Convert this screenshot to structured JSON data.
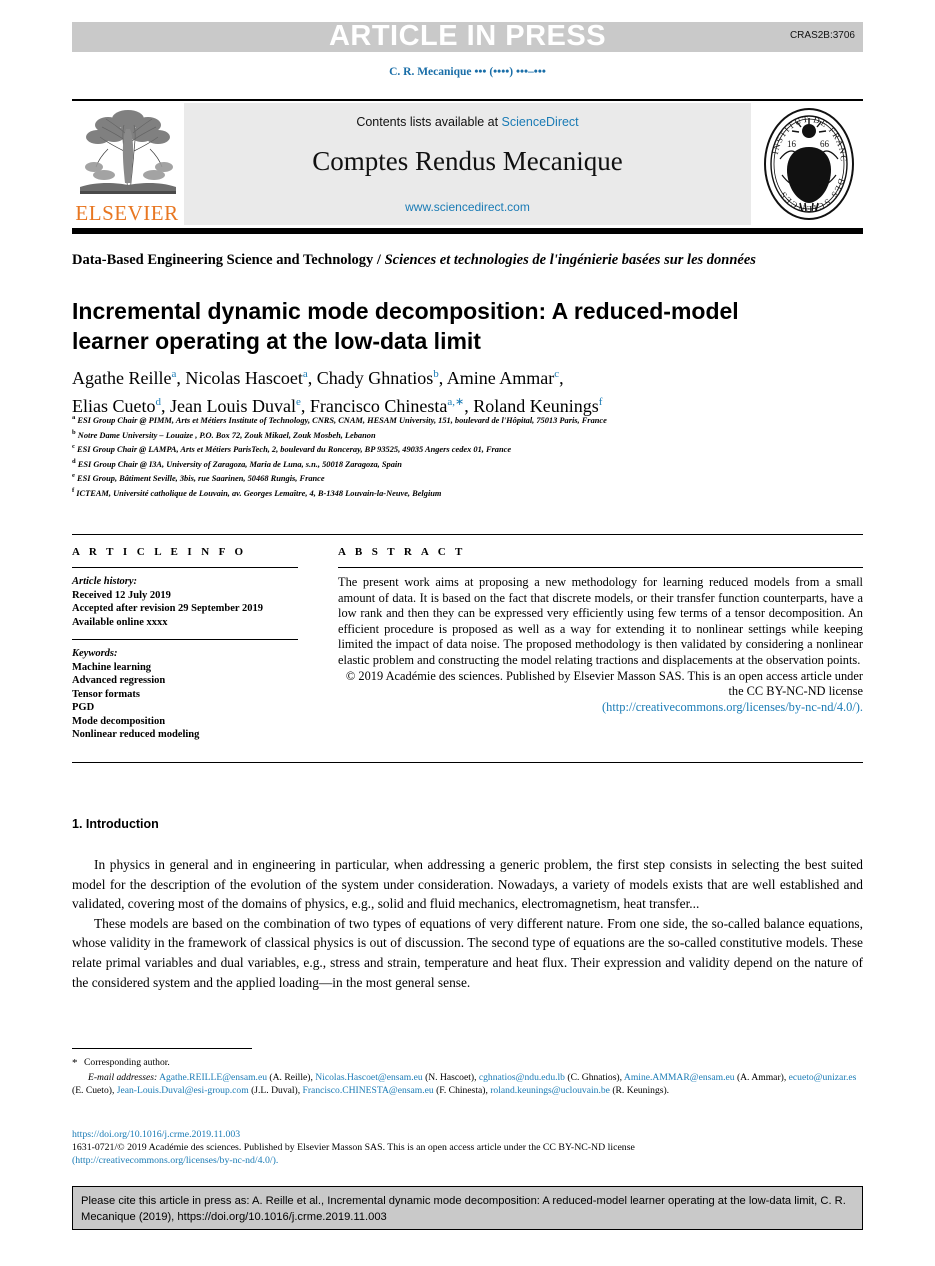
{
  "banner": {
    "label": "ARTICLE IN PRESS",
    "code": "CRAS2B:3706"
  },
  "running_head": "C. R. Mecanique ••• (••••) •••–•••",
  "masthead": {
    "contents_prefix": "Contents lists available at ",
    "sciencedirect": "ScienceDirect",
    "journal_title": "Comptes Rendus Mecanique",
    "url": "www.sciencedirect.com",
    "publisher_logo_text": "ELSEVIER",
    "seal_name": "academie-des-sciences-seal"
  },
  "series_line_en": "Data-Based Engineering Science and Technology / ",
  "series_line_fr": "Sciences et technologies de l'ingénierie basées sur les données",
  "title": "Incremental dynamic mode decomposition: A reduced-model learner operating at the low-data limit",
  "authors": [
    {
      "name": "Agathe Reille",
      "marks": "a",
      "sep": ", "
    },
    {
      "name": "Nicolas Hascoet",
      "marks": "a",
      "sep": ", "
    },
    {
      "name": "Chady Ghnatios",
      "marks": "b",
      "sep": ", "
    },
    {
      "name": "Amine Ammar",
      "marks": "c",
      "sep": ","
    },
    {
      "name": "Elias Cueto",
      "marks": "d",
      "sep": ", "
    },
    {
      "name": "Jean Louis Duval",
      "marks": "e",
      "sep": ", "
    },
    {
      "name": "Francisco Chinesta",
      "marks": "a,∗",
      "sep": ", "
    },
    {
      "name": "Roland Keunings",
      "marks": "f",
      "sep": ""
    }
  ],
  "affiliations": [
    {
      "mark": "a",
      "text": "ESI Group Chair @ PIMM, Arts et Métiers Institute of Technology, CNRS, CNAM, HESAM University, 151, boulevard de l'Hôpital, 75013 Paris, France"
    },
    {
      "mark": "b",
      "text": "Notre Dame University – Louaize , P.O. Box 72, Zouk Mikael, Zouk Mosbeh, Lebanon"
    },
    {
      "mark": "c",
      "text": "ESI Group Chair @ LAMPA, Arts et Métiers ParisTech, 2, boulevard du Ronceray, BP 93525, 49035 Angers cedex 01, France"
    },
    {
      "mark": "d",
      "text": "ESI Group Chair @ I3A, University of Zaragoza, Maria de Luna, s.n., 50018 Zaragoza, Spain"
    },
    {
      "mark": "e",
      "text": "ESI Group, Bâtiment Seville, 3bis, rue Saarinen, 50468 Rungis, France"
    },
    {
      "mark": "f",
      "text": "ICTEAM, Université catholique de Louvain, av. Georges Lemaître, 4, B-1348 Louvain-la-Neuve, Belgium"
    }
  ],
  "article_info": {
    "heading": "A R T I C L E    I N F O",
    "history_label": "Article history:",
    "history": [
      "Received 12 July 2019",
      "Accepted after revision 29 September 2019",
      "Available online xxxx"
    ],
    "keywords_label": "Keywords:",
    "keywords": [
      "Machine learning",
      "Advanced regression",
      "Tensor formats",
      "PGD",
      "Mode decomposition",
      "Nonlinear reduced modeling"
    ]
  },
  "abstract": {
    "heading": "A B S T R A C T",
    "body": "The present work aims at proposing a new methodology for learning reduced models from a small amount of data. It is based on the fact that discrete models, or their transfer function counterparts, have a low rank and then they can be expressed very efficiently using few terms of a tensor decomposition. An efficient procedure is proposed as well as a way for extending it to nonlinear settings while keeping limited the impact of data noise. The proposed methodology is then validated by considering a nonlinear elastic problem and constructing the model relating tractions and displacements at the observation points.",
    "copyright": "© 2019 Académie des sciences. Published by Elsevier Masson SAS. This is an open access article under the CC BY-NC-ND license",
    "license_url": "(http://creativecommons.org/licenses/by-nc-nd/4.0/)."
  },
  "introduction": {
    "heading": "1. Introduction",
    "paragraphs": [
      "In physics in general and in engineering in particular, when addressing a generic problem, the first step consists in selecting the best suited model for the description of the evolution of the system under consideration. Nowadays, a variety of models exists that are well established and validated, covering most of the domains of physics, e.g., solid and fluid mechanics, electromagnetism, heat transfer...",
      "These models are based on the combination of two types of equations of very different nature. From one side, the so-called balance equations, whose validity in the framework of classical physics is out of discussion. The second type of equations are the so-called constitutive models. These relate primal variables and dual variables, e.g., stress and strain, temperature and heat flux. Their expression and validity depend on the nature of the considered system and the applied loading—in the most general sense."
    ]
  },
  "footnotes": {
    "corresponding_mark": "*",
    "corresponding_text": "Corresponding author.",
    "email_label": "E-mail addresses:",
    "emails": [
      {
        "addr": "Agathe.REILLE@ensam.eu",
        "who": "(A. Reille)",
        "sep": ", "
      },
      {
        "addr": "Nicolas.Hascoet@ensam.eu",
        "who": "(N. Hascoet)",
        "sep": ", "
      },
      {
        "addr": "cghnatios@ndu.edu.lb",
        "who": "(C. Ghnatios)",
        "sep": ", "
      },
      {
        "addr": "Amine.AMMAR@ensam.eu",
        "who": "(A. Ammar)",
        "sep": ", "
      },
      {
        "addr": "ecueto@unizar.es",
        "who": "(E. Cueto)",
        "sep": ", "
      },
      {
        "addr": "Jean-Louis.Duval@esi-group.com",
        "who": "(J.L. Duval)",
        "sep": ", "
      },
      {
        "addr": "Francisco.CHINESTA@ensam.eu",
        "who": "(F. Chinesta)",
        "sep": ", "
      },
      {
        "addr": "roland.keunings@uclouvain.be",
        "who": "(R. Keunings)",
        "sep": "."
      }
    ]
  },
  "doi_block": {
    "doi_url": "https://doi.org/10.1016/j.crme.2019.11.003",
    "issn_line": "1631-0721/© 2019 Académie des sciences. Published by Elsevier Masson SAS. This is an open access article under the CC BY-NC-ND license",
    "license_line": "(http://creativecommons.org/licenses/by-nc-nd/4.0/)."
  },
  "cite_box": {
    "text": "Please cite this article in press as: A. Reille et al., Incremental dynamic mode decomposition: A reduced-model learner operating at the low-data limit, C. R. Mecanique (2019), https://doi.org/10.1016/j.crme.2019.11.003"
  },
  "colors": {
    "link": "#1a7bb5",
    "banner_bg": "#c9c9c9",
    "masthead_bg": "#eaeaea",
    "elsevier_orange": "#e87722"
  }
}
